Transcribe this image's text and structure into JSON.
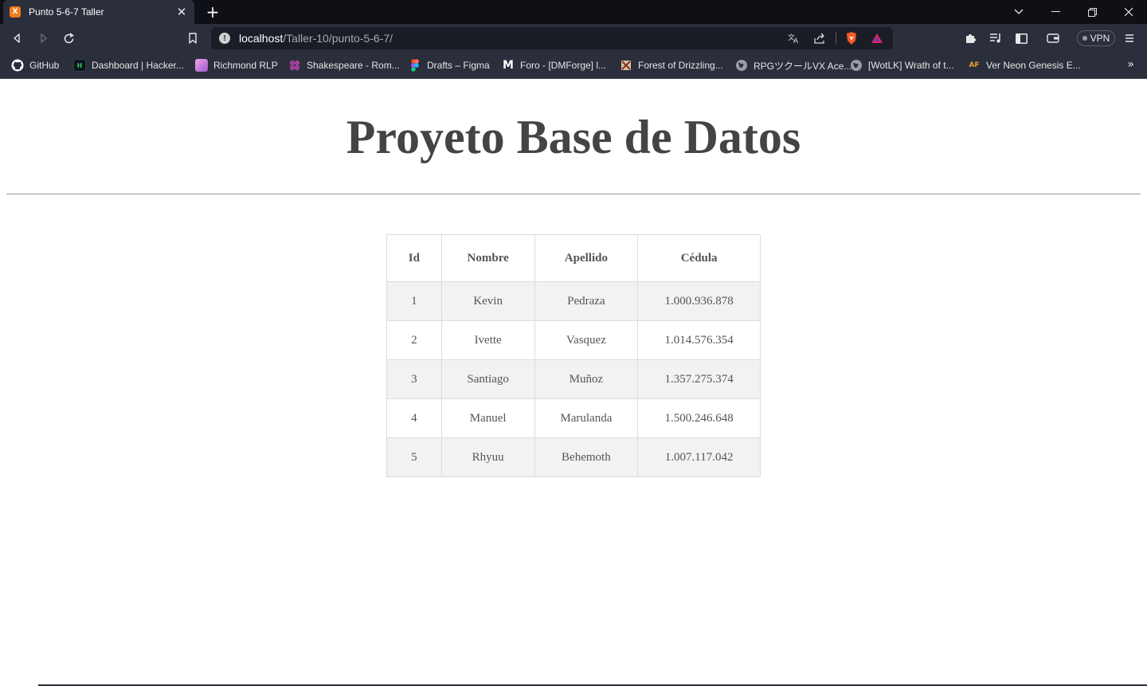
{
  "browser": {
    "tab_title": "Punto 5-6-7 Taller",
    "tab_favicon_text": "X",
    "url_host": "localhost",
    "url_path": "/Taller-10/punto-5-6-7/",
    "vpn_label": "VPN",
    "bookmarks": [
      {
        "label": "GitHub",
        "icon": "github-icon",
        "color": "#ffffff"
      },
      {
        "label": "Dashboard | Hacker...",
        "icon": "hackerrank-icon",
        "color": "#0e141e"
      },
      {
        "label": "Richmond RLP",
        "icon": "richmond-icon",
        "color": "#c86dd7"
      },
      {
        "label": "Shakespeare - Rom...",
        "icon": "shakespeare-icon",
        "color": "#8a3fa0"
      },
      {
        "label": "Drafts – Figma",
        "icon": "figma-icon",
        "color": "#f24e1e"
      },
      {
        "label": "Foro - [DMForge] l...",
        "icon": "dmforge-icon",
        "color": "#ffffff"
      },
      {
        "label": "Forest of Drizzling...",
        "icon": "forest-icon",
        "color": "#a04030"
      },
      {
        "label": "RPGツクールVX Ace...",
        "icon": "globe-icon",
        "color": "#9a9ca6"
      },
      {
        "label": "[WotLK] Wrath of t...",
        "icon": "globe-icon",
        "color": "#9a9ca6"
      },
      {
        "label": "Ver Neon Genesis E...",
        "icon": "animeflv-icon",
        "color": "#e8a020"
      }
    ]
  },
  "page": {
    "title": "Proyeto Base de Datos",
    "table": {
      "headers": [
        "Id",
        "Nombre",
        "Apellido",
        "Cédula"
      ],
      "rows": [
        [
          "1",
          "Kevin",
          "Pedraza",
          "1.000.936.878"
        ],
        [
          "2",
          "Ivette",
          "Vasquez",
          "1.014.576.354"
        ],
        [
          "3",
          "Santiago",
          "Muñoz",
          "1.357.275.374"
        ],
        [
          "4",
          "Manuel",
          "Marulanda",
          "1.500.246.648"
        ],
        [
          "5",
          "Rhyuu",
          "Behemoth",
          "1.007.117.042"
        ]
      ]
    }
  }
}
